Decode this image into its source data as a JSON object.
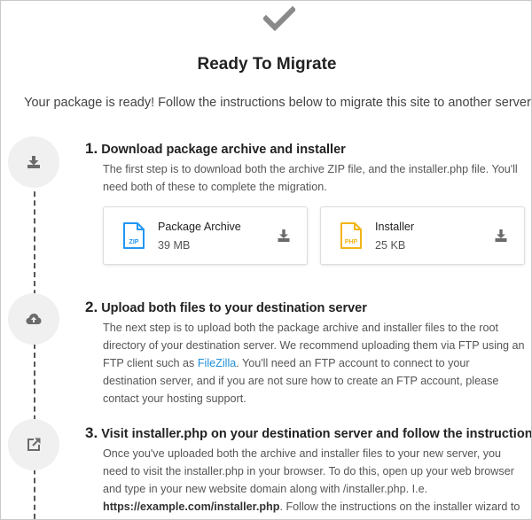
{
  "header": {
    "title": "Ready To Migrate",
    "intro": "Your package is ready! Follow the instructions below to migrate this site to another server:"
  },
  "steps": [
    {
      "number": "1.",
      "title": "Download package archive and installer",
      "body": "The first step is to download both the archive ZIP file, and the installer.php file. You'll need both of these to complete the migration."
    },
    {
      "number": "2.",
      "title": "Upload both files to your destination server",
      "body_before_link": "The next step is to upload both the package archive and installer files to the root directory of your destination server. We recommend uploading them via FTP using an FTP client such as ",
      "link": "FileZilla",
      "body_after_link": ". You'll need an FTP account to connect to your destination server, and if you are not sure how to create an FTP account, please contact your hosting support."
    },
    {
      "number": "3.",
      "title": "Visit installer.php on your destination server and follow the instructions",
      "body_before_url": "Once you've uploaded both the archive and installer files to your new server, you need to visit the installer.php in your browser. To do this, open up your web browser and type in your new website domain along with /installer.php. I.e. ",
      "url": "https://example.com/installer.php",
      "body_after_url": ". Follow the instructions on the installer wizard to complete the migration."
    }
  ],
  "files": [
    {
      "name": "Package Archive",
      "size": "39 MB",
      "badge": "ZIP",
      "icon": "zip-file-icon",
      "color": "#2196f3"
    },
    {
      "name": "Installer",
      "size": "25 KB",
      "badge": "PHP",
      "icon": "php-file-icon",
      "color": "#f2b418"
    }
  ],
  "colors": {
    "link": "#1f8fd8",
    "icon_gray": "#6b6b6b",
    "check": "#8a8a8a",
    "circle_bg": "#f0f0f0"
  }
}
